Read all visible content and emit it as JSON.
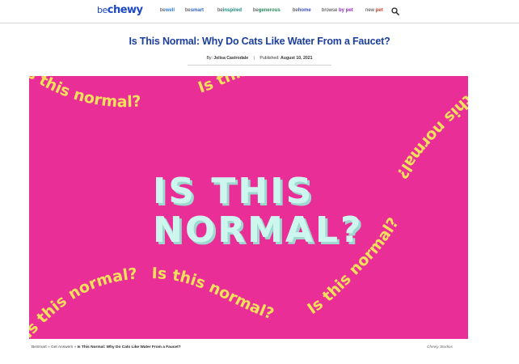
{
  "header": {
    "logo": {
      "prefix": "be",
      "name": "chewy"
    },
    "nav": [
      {
        "prefix": "be",
        "word": "well",
        "color": "#2b7fd8"
      },
      {
        "prefix": "be",
        "word": "smart",
        "color": "#2b63c9"
      },
      {
        "prefix": "be",
        "word": "inspired",
        "color": "#18897e"
      },
      {
        "prefix": "be",
        "word": "generous",
        "color": "#1e8a53"
      },
      {
        "prefix": "be",
        "word": "home",
        "color": "#3c4ec7"
      },
      {
        "prefix": "browse ",
        "word": "by pet",
        "color": "#8a2bb6"
      },
      {
        "prefix": "new ",
        "word": "pet",
        "color": "#d83a2b"
      }
    ],
    "search_icon": "search-icon"
  },
  "article": {
    "title": "Is This Normal: Why Do Cats Like Water From a Faucet?",
    "by_label": "By:",
    "author": "Jelisa Castrodale",
    "separator": "|",
    "published_label": "Published:",
    "published_date": "August 10, 2021"
  },
  "hero": {
    "background": "#ea2e97",
    "headline_line1": "IS THIS",
    "headline_line2": "NORMAL?",
    "headline_color": "#cdf6ef",
    "wave_text": "Is this normal?",
    "wave_color": "#f4e15b"
  },
  "footer": {
    "breadcrumb": [
      "BeSmart",
      "Get Answers",
      "Is This Normal: Why Do Cats Like Water From a Faucet?"
    ],
    "breadcrumb_sep": "»",
    "credit": "Chewy Studios"
  }
}
